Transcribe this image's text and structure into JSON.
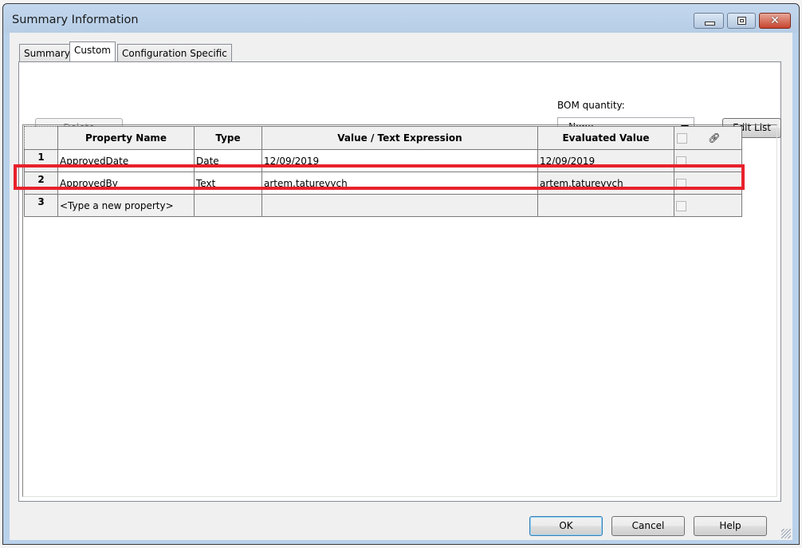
{
  "window": {
    "title": "Summary Information",
    "controls": {
      "minimize": "minimize",
      "maximize": "maximize",
      "close": "close"
    }
  },
  "tabs": [
    {
      "label": "Summary",
      "active": false
    },
    {
      "label": "Custom",
      "active": true
    },
    {
      "label": "Configuration Specific",
      "active": false
    }
  ],
  "toolbar": {
    "delete_label": "Delete",
    "bom_quantity_label": "BOM quantity:",
    "bom_quantity_value": "- None -",
    "edit_list_label": "Edit List"
  },
  "grid": {
    "columns": [
      "Property Name",
      "Type",
      "Value / Text Expression",
      "Evaluated Value"
    ],
    "link_icon": "link-icon",
    "rows": [
      {
        "num": "1",
        "name": "ApprovedDate",
        "type": "Date",
        "value": "12/09/2019",
        "evaluated": "12/09/2019",
        "checked": false
      },
      {
        "num": "2",
        "name": "ApprovedBy",
        "type": "Text",
        "value": "artem.taturevych",
        "evaluated": "artem.taturevych",
        "checked": false,
        "highlighted": true
      },
      {
        "num": "3",
        "name": "<Type a new property>",
        "type": "",
        "value": "",
        "evaluated": "",
        "checked": false
      }
    ]
  },
  "footer": {
    "ok_label": "OK",
    "cancel_label": "Cancel",
    "help_label": "Help"
  },
  "colors": {
    "highlight": "#e8212b",
    "titlebar": "#b9d1ea"
  }
}
